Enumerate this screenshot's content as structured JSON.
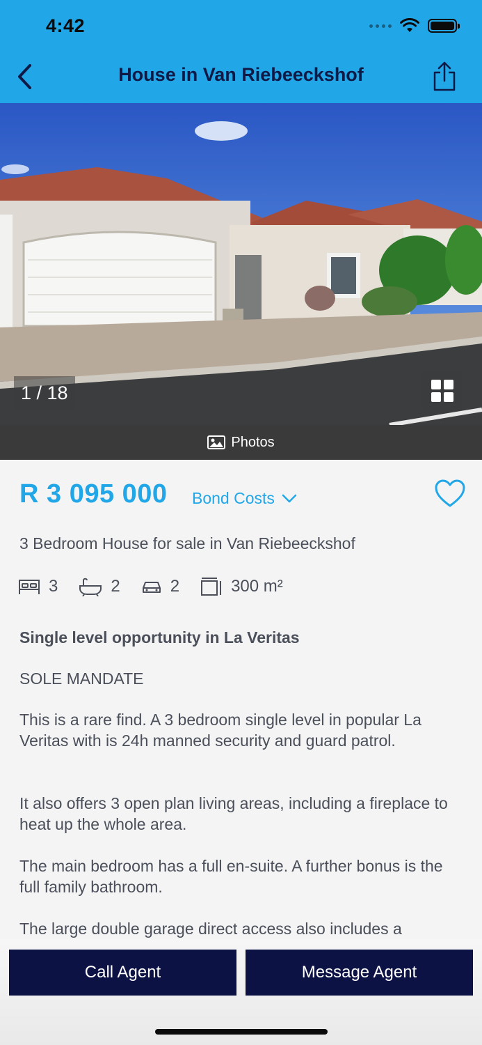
{
  "status": {
    "time": "4:42"
  },
  "nav": {
    "title": "House in Van Riebeeckshof",
    "back_icon": "chevron-left-icon",
    "share_icon": "share-icon"
  },
  "gallery": {
    "counter": "1 / 18",
    "photos_label": "Photos"
  },
  "listing": {
    "price": "R 3 095 000",
    "bond_label": "Bond Costs",
    "subtitle": "3 Bedroom House for sale in Van Riebeeckshof",
    "features": {
      "bedrooms": "3",
      "bathrooms": "2",
      "garages": "2",
      "floor_size": "300 m²"
    },
    "heading": "Single level opportunity in La Veritas",
    "paragraphs": [
      "SOLE MANDATE",
      "This is a rare find.  A 3 bedroom single level in popular La Veritas with is 24h manned security and guard patrol.",
      "It also offers 3 open plan living areas, including a fireplace to heat up the whole area.",
      "The main bedroom has a full en-suite.  A further bonus is the full family bathroom.",
      "The large double garage direct access also includes a"
    ]
  },
  "actions": {
    "call": "Call Agent",
    "message": "Message Agent"
  },
  "colors": {
    "accent": "#21a7e8",
    "navy": "#0d1245",
    "text": "#4a4f5a"
  }
}
